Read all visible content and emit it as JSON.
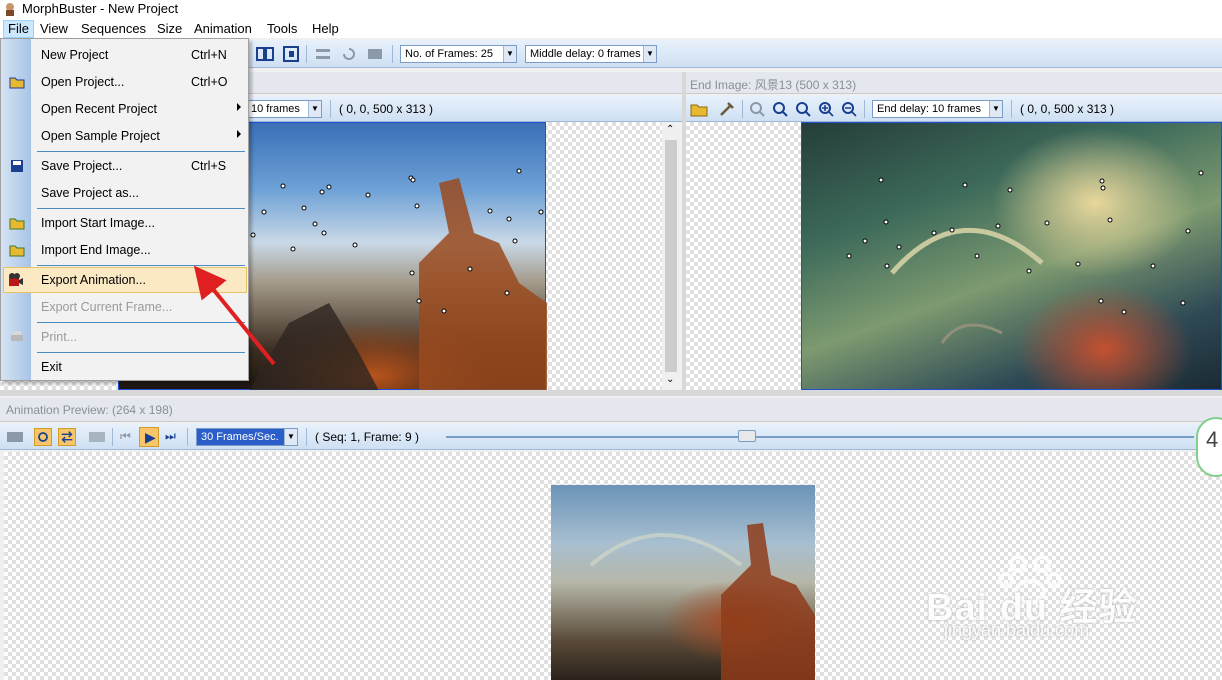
{
  "window": {
    "title": "MorphBuster - New Project"
  },
  "menubar": [
    "File",
    "View",
    "Sequences",
    "Size",
    "Animation",
    "Tools",
    "Help"
  ],
  "main_toolbar": {
    "frames_dropdown": "No. of Frames: 25",
    "middle_delay_dropdown": "Middle delay: 0 frames"
  },
  "start_panel": {
    "delay_dropdown": "10 frames",
    "coords": "( 0, 0, 500 x 313 )"
  },
  "end_panel": {
    "header": "End Image: 风景13 (500 x 313)",
    "delay_dropdown": "End delay: 10 frames",
    "coords": "( 0, 0, 500 x 313 )"
  },
  "preview_panel": {
    "header": "Animation Preview:  (264 x 198)",
    "fps_dropdown": "30 Frames/Sec.",
    "status": "( Seq: 1, Frame: 9 )",
    "corner_badge": "4"
  },
  "file_menu": {
    "items": [
      {
        "label": "New Project",
        "shortcut": "Ctrl+N"
      },
      {
        "label": "Open Project...",
        "shortcut": "Ctrl+O"
      },
      {
        "label": "Open Recent Project",
        "shortcut": ""
      },
      {
        "label": "Open Sample Project",
        "shortcut": ""
      },
      {
        "label": "Save Project...",
        "shortcut": "Ctrl+S"
      },
      {
        "label": "Save Project as...",
        "shortcut": ""
      },
      {
        "label": "Import Start Image...",
        "shortcut": ""
      },
      {
        "label": "Import End Image...",
        "shortcut": ""
      },
      {
        "label": "Export Animation...",
        "shortcut": ""
      },
      {
        "label": "Export Current Frame...",
        "shortcut": ""
      },
      {
        "label": "Print...",
        "shortcut": ""
      },
      {
        "label": "Exit",
        "shortcut": ""
      }
    ]
  },
  "watermark": {
    "brand": "Bai du 经验",
    "url": "jingyan.baidu.com"
  },
  "colors": {
    "accent": "#e02020",
    "menu_highlight": "#fbe9c4",
    "toolbar": "#cfe0f3"
  }
}
